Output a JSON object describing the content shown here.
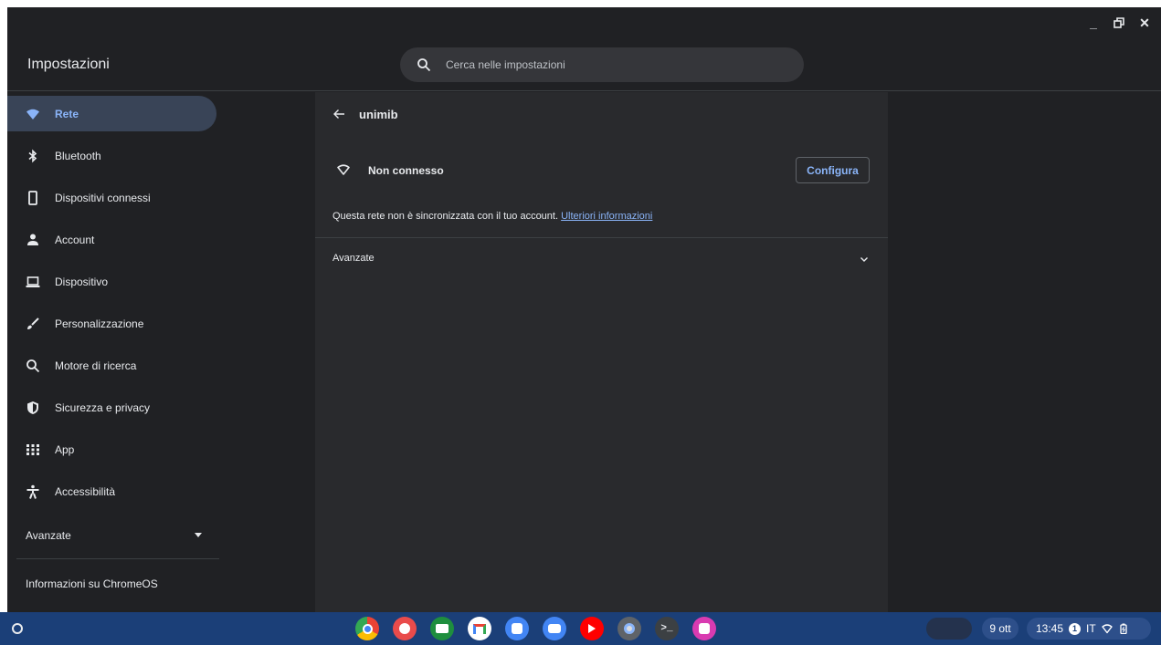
{
  "window": {
    "controls": {
      "minimize": "_",
      "close": "✕"
    }
  },
  "header": {
    "title": "Impostazioni",
    "search_placeholder": "Cerca nelle impostazioni"
  },
  "sidebar": {
    "items": [
      {
        "label": "Rete",
        "icon": "wifi-icon",
        "active": true
      },
      {
        "label": "Bluetooth",
        "icon": "bluetooth-icon"
      },
      {
        "label": "Dispositivi connessi",
        "icon": "phone-icon"
      },
      {
        "label": "Account",
        "icon": "person-icon"
      },
      {
        "label": "Dispositivo",
        "icon": "laptop-icon"
      },
      {
        "label": "Personalizzazione",
        "icon": "brush-icon"
      },
      {
        "label": "Motore di ricerca",
        "icon": "search-icon"
      },
      {
        "label": "Sicurezza e privacy",
        "icon": "shield-icon"
      },
      {
        "label": "App",
        "icon": "apps-grid-icon"
      },
      {
        "label": "Accessibilità",
        "icon": "accessibility-icon"
      }
    ],
    "advanced": "Avanzate",
    "about": "Informazioni su ChromeOS"
  },
  "main": {
    "network_name": "unimib",
    "status": "Non connesso",
    "configure_button": "Configura",
    "sync_message": "Questa rete non è sincronizzata con il tuo account.",
    "sync_link": "Ulteriori informazioni",
    "advanced_section": "Avanzate"
  },
  "shelf": {
    "apps": [
      {
        "name": "chrome",
        "color": "#ea4335"
      },
      {
        "name": "canvas",
        "color": "#e94b4b"
      },
      {
        "name": "classroom",
        "color": "#1e8e3e"
      },
      {
        "name": "gmail",
        "color": "#ffffff"
      },
      {
        "name": "calendar",
        "color": "#4285f4"
      },
      {
        "name": "files",
        "color": "#4285f4"
      },
      {
        "name": "youtube",
        "color": "#ff0000"
      },
      {
        "name": "settings",
        "color": "#5f6368"
      },
      {
        "name": "terminal",
        "color": "#3c4043"
      },
      {
        "name": "photo-app",
        "color": "#d93bb1"
      }
    ],
    "date": "9 ott",
    "time": "13:45",
    "notification_count": "1",
    "keyboard_layout": "IT"
  },
  "colors": {
    "accent": "#8ab4f8",
    "active_bg": "#394457",
    "shelf_bg": "#1b3f78"
  }
}
